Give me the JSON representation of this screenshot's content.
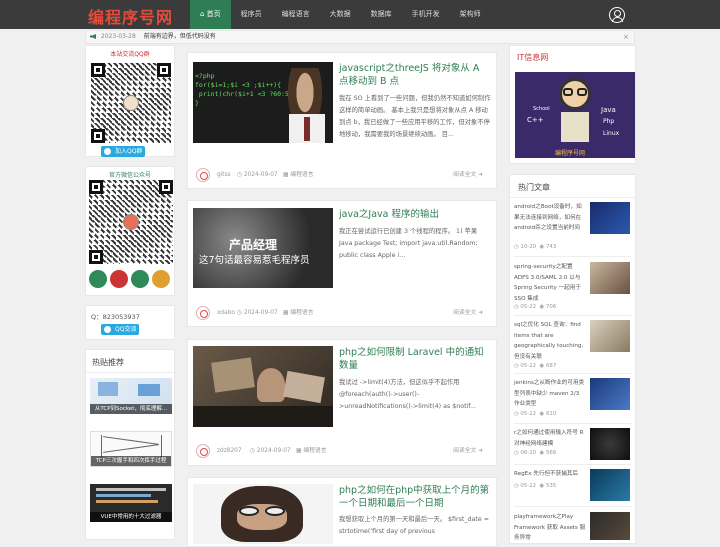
{
  "nav": {
    "logo": "编程序号网",
    "menu": [
      "首页",
      "程序员",
      "编程语言",
      "大数据",
      "数据库",
      "手机开发",
      "架构师"
    ]
  },
  "notice": {
    "date": "2023-03-28",
    "message": "前端有边界，但低代码没有"
  },
  "left": {
    "qq_group_title": "本站交流QQ群",
    "qq_group_button": "加入QQ群",
    "wechat_title": "官方微信公众号",
    "qq_number": "Q：823053937",
    "qq_contact_button": "QQ交谈",
    "hot_title": "热贴推荐",
    "hot_posts": [
      "从TCP到Socket，彻底理解...",
      "TCP三次握手和四次挥手过程",
      "VUE中常用的十大过滤器"
    ]
  },
  "posts": [
    {
      "title": "javascript之threeJS 将对象从 A 点移动到 B 点",
      "excerpt": "我在 SO 上看到了一些问题，但我仍然不知道如何制作这样的简单动画。 基本上我只是想将对象从点 A 移动到点 b，我已经做了一些应用平移的工作，但对象不停地移动，我需要我的场景继续动画。 目...",
      "author": "gitss",
      "date": "2024-09-07",
      "category": "编程语言",
      "more": "阅读全文"
    },
    {
      "title": "java之Java 程序的输出",
      "excerpt": "我正在尝试运行已创建 3 个线程的程序。 1) 苹果 Java package Test; import java.util.Random; public class Apple i...",
      "author": "xdabo",
      "date": "2024-09-07",
      "category": "编程语言",
      "more": "阅读全文",
      "image_text": [
        "产品经理",
        "这7句话最容易惹毛程序员"
      ]
    },
    {
      "title": "php之如何限制 Laravel 中的通知数量",
      "excerpt": "我试过 ->limit(4)方法，但这似乎不起作用 @foreach(auth()->user()->unreadNotifications()->limit(4) as $notif...",
      "author": "zdz8207",
      "date": "2024-09-07",
      "category": "编程语言",
      "more": "阅读全文"
    },
    {
      "title": "php之如何在php中获取上个月的第一个日期和最后一个日期",
      "excerpt": "我想获取上个月的第一天和最后一天。 $first_date = strtotime('first day of previous",
      "author": "",
      "date": "",
      "category": "",
      "more": ""
    }
  ],
  "right": {
    "it_title": "IT信息网",
    "it_banner": {
      "c": "C++",
      "java": "Java",
      "php": "Php",
      "linux": "Linux",
      "school": "School",
      "site": "编程序号网"
    },
    "hot_articles_title": "热门文章",
    "hot_articles": [
      {
        "text": "android之Boot设备时，如果无法连接到网络，如何在android杀之设置当前时间",
        "date": "10-20",
        "views": "743"
      },
      {
        "text": "spring-security之配置ADFS 3.0/SAML 2.0 以与 Spring Security 一起用于 SSO 集成",
        "date": "05-22",
        "views": "706"
      },
      {
        "text": "sql之优化 SQL 查询：find items that are geographically touching, 但没有关联",
        "date": "05-22",
        "views": "687"
      },
      {
        "text": "jenkins之从断作业的可用类型列表中缺少 maven 2/3 作业类型",
        "date": "05-22",
        "views": "610"
      },
      {
        "text": "r之如何通过使用输入符号 R 对神经网络建模",
        "date": "06-20",
        "views": "566"
      },
      {
        "text": "RegEx 先行但不获捕其后",
        "date": "05-22",
        "views": "535"
      },
      {
        "text": "playframework之Play Framework 获取 Assets 服务异常",
        "date": "",
        "views": ""
      }
    ]
  },
  "colors": {
    "nav_bg": "#3b3b3b",
    "accent": "#2f7d54",
    "logo": "#e34c3c"
  }
}
